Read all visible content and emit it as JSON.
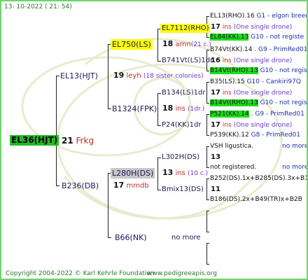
{
  "header": {
    "date": "13- 10-2022 ( 21: 54)"
  },
  "footer": {
    "copyright": "Copyright 2004-2022 © Karl Kehrle Foundation",
    "site": "www.pedigreeapis.org"
  },
  "colors": {
    "border": "#6dd66d",
    "root_bg": "#22bb22",
    "yellow": "#ffff00",
    "green": "#22dd22",
    "grey": "#c8c8c8",
    "text_navy": "#1a1a5a",
    "text_red": "#c0302a"
  },
  "root": {
    "label": "EL36(HJT)",
    "count": "21",
    "origin": "Frkg"
  },
  "gen1": [
    {
      "label": "EL13(HJT)",
      "count": "19",
      "origin": "leyh",
      "note": "(18 sister colonies)"
    },
    {
      "label": "B236(DB)",
      "count": "17",
      "origin": "mmdb"
    }
  ],
  "gen2": [
    {
      "label": "EL750(LS)",
      "count": "18",
      "origin": "amn",
      "note": "(21 c.)"
    },
    {
      "label": "B1324(FPK)",
      "count": "18",
      "origin": "ins",
      "note": "(1dr.)"
    },
    {
      "label": "L280H(DS)",
      "count": "13",
      "origin": "ins",
      "note": "(10 c.)"
    },
    {
      "label": "B66(NK)",
      "note": "no more"
    }
  ],
  "gen3": [
    {
      "label": "EL7112(RHO)",
      "count": "17",
      "origin": "ins",
      "note": "(One single drone)"
    },
    {
      "label": "B741Vt(LS)1dr",
      "count": "16",
      "origin": "ins",
      "note": "(One single drone)"
    },
    {
      "label": "B134(LS)1dr",
      "count": "17",
      "origin": "ins",
      "note": "(One single drone)"
    },
    {
      "label": "P24(KK)1dr",
      "count": "17",
      "origin": "ins",
      "note": "(One single drone)"
    },
    {
      "label": "L302H(DS)",
      "count": "13"
    },
    {
      "label": "Bmix13(DS)",
      "count": "11"
    }
  ],
  "gen4": [
    {
      "label": "EL13(RHO).16",
      "tail": "G1 - elgon breed"
    },
    {
      "label": "EL84(KK).13",
      "tail": "G10 - not registe"
    },
    {
      "label": "B74Vt(KK).14",
      "tail": ". G9 - PrimRed01"
    },
    {
      "label": "B14Vt(RHO).13",
      "tail": "G10 - not registe"
    },
    {
      "label": "B35(LS).15",
      "tail": "G10 - Cankiri97Q"
    },
    {
      "label": "B14Vt(RHO).13",
      "tail": "G10 - not registe"
    },
    {
      "label": "P521(KK).14",
      "tail": ". G9 - PrimRed01"
    },
    {
      "label": "P539(KK).12",
      "tail": "G8 - PrimRed01"
    },
    {
      "label": "VSH ligustica.",
      "tail": "no more"
    },
    {
      "label": "not registered.",
      "tail": "no more"
    },
    {
      "label": "B252(DS).1x+B285(DS).3x+B1"
    },
    {
      "label": "B186(DS).2x+B49(TR)x+B2B"
    }
  ]
}
